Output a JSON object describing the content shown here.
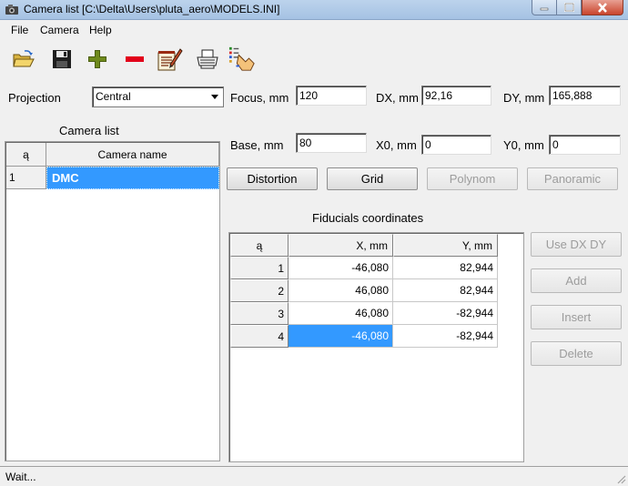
{
  "window": {
    "title": "Camera list [C:\\Delta\\Users\\pluta_aero\\MODELS.INI]"
  },
  "menu": {
    "file": "File",
    "camera": "Camera",
    "help": "Help"
  },
  "toolbar": {
    "icons": [
      "open-folder-icon",
      "save-icon",
      "add-icon",
      "remove-icon",
      "edit-notes-icon",
      "print-icon",
      "hand-pointer-icon"
    ]
  },
  "projection": {
    "label": "Projection",
    "value": "Central"
  },
  "params": {
    "focus": {
      "label": "Focus, mm",
      "value": "120"
    },
    "dx": {
      "label": "DX, mm",
      "value": "92,16"
    },
    "dy": {
      "label": "DY, mm",
      "value": "165,888"
    },
    "base": {
      "label": "Base, mm",
      "value": "80"
    },
    "x0": {
      "label": "X0, mm",
      "value": "0"
    },
    "y0": {
      "label": "Y0, mm",
      "value": "0"
    }
  },
  "buttons": {
    "distortion": "Distortion",
    "grid": "Grid",
    "polynom": "Polynom",
    "panoramic": "Panoramic",
    "use_dx_dy": "Use DX DY",
    "add": "Add",
    "insert": "Insert",
    "delete": "Delete"
  },
  "camera_list": {
    "title": "Camera list",
    "col_num": "ą",
    "col_name": "Camera name",
    "rows": [
      {
        "num": "1",
        "name": "DMC"
      }
    ]
  },
  "fiducials": {
    "title": "Fiducials coordinates",
    "col_num": "ą",
    "col_x": "X, mm",
    "col_y": "Y, mm",
    "rows": [
      {
        "num": "1",
        "x": "-46,080",
        "y": "82,944"
      },
      {
        "num": "2",
        "x": "46,080",
        "y": "82,944"
      },
      {
        "num": "3",
        "x": "46,080",
        "y": "-82,944"
      },
      {
        "num": "4",
        "x": "-46,080",
        "y": "-82,944"
      }
    ]
  },
  "status": {
    "text": "Wait..."
  }
}
